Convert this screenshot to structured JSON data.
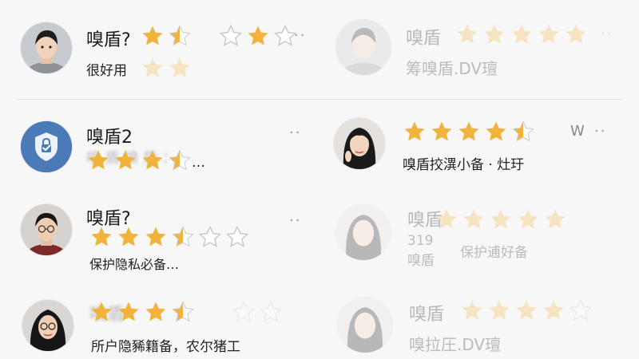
{
  "reviews": [
    {
      "name": "嗅盾?",
      "text": "很好用",
      "rating": 2,
      "avatar": "young-man-avatar"
    },
    {
      "name": "嗅盾2",
      "text": "…",
      "rating": 3.5,
      "avatar": "shield-lock-app-icon"
    },
    {
      "name": "嗅盾?",
      "text": "保护隐私必备…",
      "rating": 3.5,
      "avatar": "young-man-glasses-avatar"
    },
    {
      "name": "",
      "text": "所户隐豨籍备，农尔猪工",
      "rating": 3.5,
      "avatar": "woman-glasses-avatar"
    }
  ],
  "right_reviews": [
    {
      "name": "嗅盾",
      "text": "筹嗅盾.DV璮",
      "rating": 4.5,
      "avatar": "young-man-avatar"
    },
    {
      "name": "",
      "text": "嗅盾挍潩小备 · 灶玗",
      "rating": 4.5,
      "avatar": "young-woman-avatar",
      "extra": "W"
    },
    {
      "name": "嗅盾",
      "text": "保护逋好备",
      "extra_left": "319",
      "extra_left2": "嗅盾",
      "rating": 4,
      "avatar": "young-woman-avatar"
    },
    {
      "name": "嗅盾",
      "text": "嗅拉圧.DV璮",
      "rating": 3.5,
      "avatar": "young-woman-avatar"
    }
  ],
  "colors": {
    "star": "#f2b33d",
    "star_empty": "#c9c9c9",
    "shield_bg": "#4a7ab8"
  },
  "menu_dots": "··"
}
